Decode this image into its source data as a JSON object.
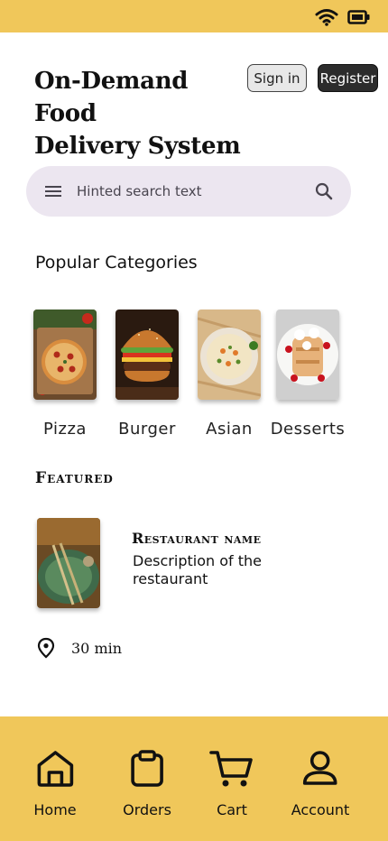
{
  "app": {
    "title_line1": "On-Demand Food",
    "title_line2": "Delivery System"
  },
  "header": {
    "signin_label": "Sign in",
    "register_label": "Register"
  },
  "search": {
    "placeholder": "Hinted search text"
  },
  "categories": {
    "title": "Popular Categories",
    "items": [
      {
        "label": "Pizza",
        "icon": "pizza-image"
      },
      {
        "label": "Burger",
        "icon": "burger-image"
      },
      {
        "label": "Asian",
        "icon": "asian-food-image"
      },
      {
        "label": "Desserts",
        "icon": "desserts-image"
      }
    ]
  },
  "featured": {
    "title": "Featured",
    "restaurant": {
      "name": "Restaurant name",
      "description": "Description of the restaurant",
      "time": "30 min",
      "icon": "location-pin-icon"
    }
  },
  "nav": {
    "items": [
      {
        "label": "Home",
        "icon": "home-icon"
      },
      {
        "label": "Orders",
        "icon": "clipboard-icon"
      },
      {
        "label": "Cart",
        "icon": "cart-icon"
      },
      {
        "label": "Account",
        "icon": "account-icon"
      }
    ]
  },
  "colors": {
    "accent": "#f0c75a",
    "search_bg": "#ece6f0",
    "register_bg": "#2c2c2c"
  }
}
